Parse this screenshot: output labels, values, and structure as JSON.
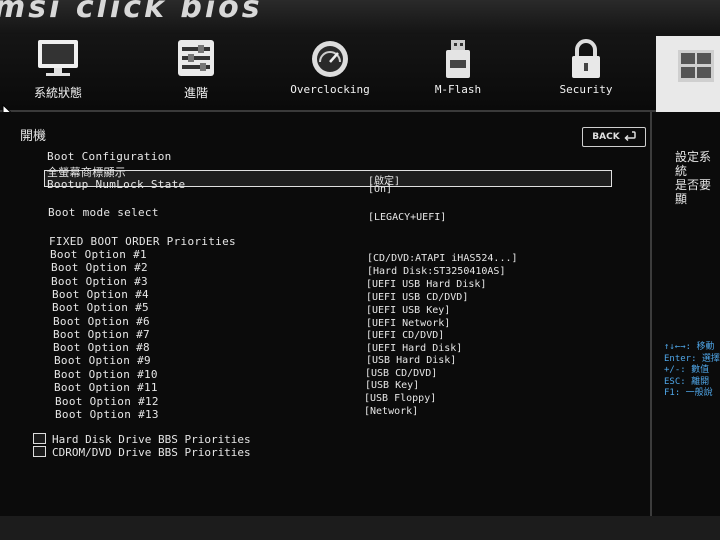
{
  "brand": {
    "logo": "msi click bios"
  },
  "nav": {
    "items": [
      {
        "label": "系統狀態",
        "icon": "monitor-icon"
      },
      {
        "label": "進階",
        "icon": "settings-sliders-icon"
      },
      {
        "label": "Overclocking",
        "icon": "gauge-icon"
      },
      {
        "label": "M-Flash",
        "icon": "usb-drive-icon"
      },
      {
        "label": "Security",
        "icon": "lock-icon"
      }
    ],
    "active_icon": "boot-grid-icon"
  },
  "section": {
    "title": "開機",
    "back_label": "BACK"
  },
  "settings": {
    "boot_configuration": "Boot Configuration",
    "fullscreen_logo": {
      "label": "全螢幕商標顯示",
      "value": "[啟定]"
    },
    "numlock": {
      "label": "Bootup NumLock State",
      "value": "[On]"
    },
    "boot_mode": {
      "label": "Boot mode select",
      "value": "[LEGACY+UEFI]"
    },
    "fixed_order_heading": "FIXED BOOT ORDER Priorities",
    "boot_options": [
      {
        "label": "Boot Option #1",
        "value": "[CD/DVD:ATAPI   iHAS524...]"
      },
      {
        "label": "Boot Option #2",
        "value": "[Hard Disk:ST3250410AS]"
      },
      {
        "label": "Boot Option #3",
        "value": "[UEFI USB Hard Disk]"
      },
      {
        "label": "Boot Option #4",
        "value": "[UEFI USB CD/DVD]"
      },
      {
        "label": "Boot Option #5",
        "value": "[UEFI USB Key]"
      },
      {
        "label": "Boot Option #6",
        "value": "[UEFI Network]"
      },
      {
        "label": "Boot Option #7",
        "value": "[UEFI CD/DVD]"
      },
      {
        "label": "Boot Option #8",
        "value": "[UEFI Hard Disk]"
      },
      {
        "label": "Boot Option #9",
        "value": "[USB Hard Disk]"
      },
      {
        "label": "Boot Option #10",
        "value": "[USB CD/DVD]"
      },
      {
        "label": "Boot Option #11",
        "value": "[USB Key]"
      },
      {
        "label": "Boot Option #12",
        "value": "[USB Floppy]"
      },
      {
        "label": "Boot Option #13",
        "value": "[Network]"
      }
    ],
    "submenus": [
      {
        "label": "Hard Disk Drive BBS Priorities"
      },
      {
        "label": "CDROM/DVD Drive BBS Priorities"
      }
    ]
  },
  "help": {
    "line1": "設定系統",
    "line2": "是否要顯"
  },
  "keys": [
    "↑↓←→: 移動",
    "Enter: 選擇",
    "+/-: 數值",
    "ESC: 離開",
    "F1: 一般說"
  ],
  "colors": {
    "background": "#050505",
    "text": "#e6e6e6",
    "key_help": "#4fa6e8",
    "active_tab": "#e9e9e9"
  }
}
